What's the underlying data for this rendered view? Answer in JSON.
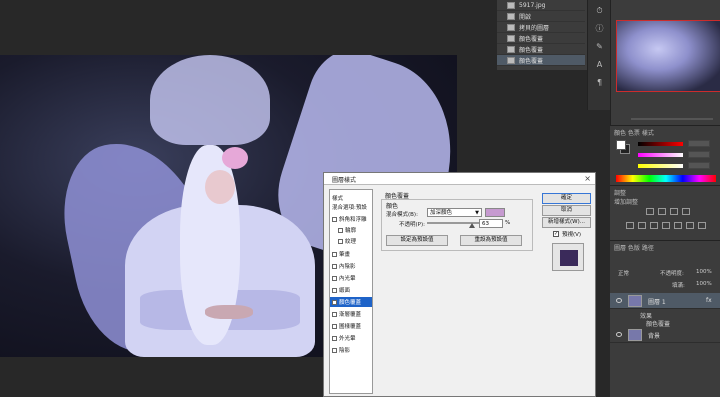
{
  "history": {
    "tab_label": "5917.jpg",
    "items": [
      {
        "label": "開啟"
      },
      {
        "label": "拷貝的圖層"
      },
      {
        "label": "顏色覆蓋"
      },
      {
        "label": "顏色覆蓋"
      },
      {
        "label": "顏色覆蓋"
      }
    ]
  },
  "color_panel": {
    "tabs": "顏色  色票  樣式"
  },
  "adjustments": {
    "title": "調整",
    "subtitle": "增加調整"
  },
  "layers": {
    "tabs": "圖層  色版  路徑",
    "blend_mode": "正常",
    "opacity_label": "不透明度:",
    "opacity_value": "100%",
    "fill_label": "填滿:",
    "fill_value": "100%",
    "rows": [
      {
        "name": "圖層 1",
        "fx": "fx"
      },
      {
        "name": "背景",
        "fx": ""
      }
    ],
    "effects_label": "效果",
    "effect_item": "顏色覆蓋"
  },
  "dialog": {
    "title": "圖層樣式",
    "close": "×",
    "style_list_title": "樣式",
    "styles": [
      {
        "label": "混合選項:預設",
        "checkbox": false,
        "selected": false
      },
      {
        "label": "斜角和浮雕",
        "checkbox": true,
        "selected": false
      },
      {
        "label": "輪廓",
        "checkbox": true,
        "selected": false,
        "indent": true
      },
      {
        "label": "紋理",
        "checkbox": true,
        "selected": false,
        "indent": true
      },
      {
        "label": "筆畫",
        "checkbox": true,
        "selected": false
      },
      {
        "label": "內陰影",
        "checkbox": true,
        "selected": false
      },
      {
        "label": "內光暈",
        "checkbox": true,
        "selected": false
      },
      {
        "label": "緞面",
        "checkbox": true,
        "selected": false
      },
      {
        "label": "顏色覆蓋",
        "checkbox": true,
        "selected": true
      },
      {
        "label": "漸層覆蓋",
        "checkbox": true,
        "selected": false
      },
      {
        "label": "圖樣覆蓋",
        "checkbox": true,
        "selected": false
      },
      {
        "label": "外光暈",
        "checkbox": true,
        "selected": false
      },
      {
        "label": "陰影",
        "checkbox": true,
        "selected": false
      }
    ],
    "overlay_group_title": "顏色覆蓋",
    "color_sub_title": "顏色",
    "blend_mode_label": "混合模式(B):",
    "blend_mode_value": "加深顏色",
    "overlay_color": "#c69ad0",
    "opacity_label": "不透明(P):",
    "opacity_value": "63",
    "opacity_unit": "%",
    "opacity_fraction": 0.63,
    "make_default": "設定為預設值",
    "reset_default": "重設為預設值",
    "ok": "確定",
    "cancel": "取消",
    "new_style": "新增樣式(W)...",
    "preview_label": "預視(V)",
    "preview_checked": true,
    "preview_color": "#3a2a5a"
  }
}
